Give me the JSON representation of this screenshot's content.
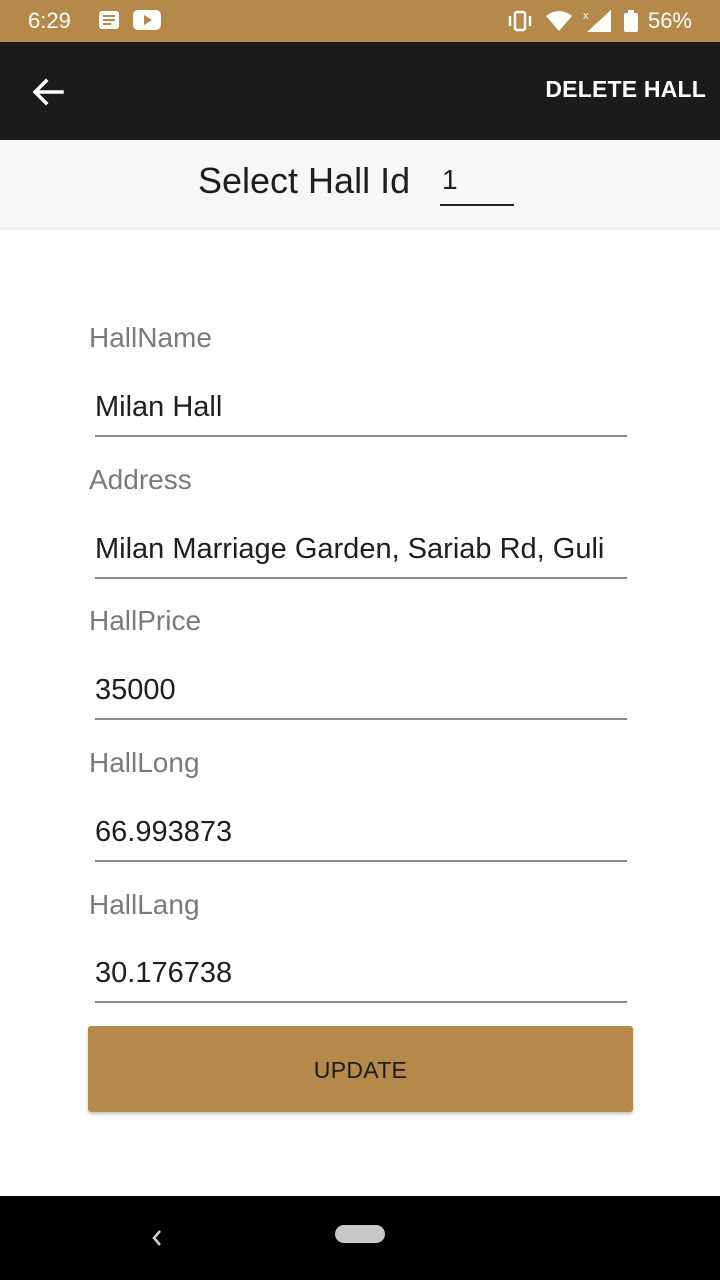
{
  "status_bar": {
    "time": "6:29",
    "battery": "56%",
    "icons": [
      "message-icon",
      "youtube-icon",
      "vibrate-icon",
      "wifi-icon",
      "signal-icon",
      "battery-icon"
    ],
    "color": "#b5894a"
  },
  "app_bar": {
    "back_icon": "back-arrow-icon",
    "delete_label": "DELETE HALL",
    "color": "#1b1b1b"
  },
  "hall_select": {
    "label": "Select Hall Id",
    "value": "1"
  },
  "form": {
    "fields": [
      {
        "label": "HallName",
        "value": "Milan Hall"
      },
      {
        "label": "Address",
        "value": "Milan Marriage Garden, Sariab Rd, Guli"
      },
      {
        "label": "HallPrice",
        "value": "35000"
      },
      {
        "label": "HallLong",
        "value": "66.993873"
      },
      {
        "label": "HallLang",
        "value": "30.176738"
      }
    ],
    "update_label": "UPDATE",
    "accent": "#b5894a"
  },
  "nav_bar": {
    "icons": [
      "nav-back-icon",
      "home-pill-icon"
    ]
  }
}
